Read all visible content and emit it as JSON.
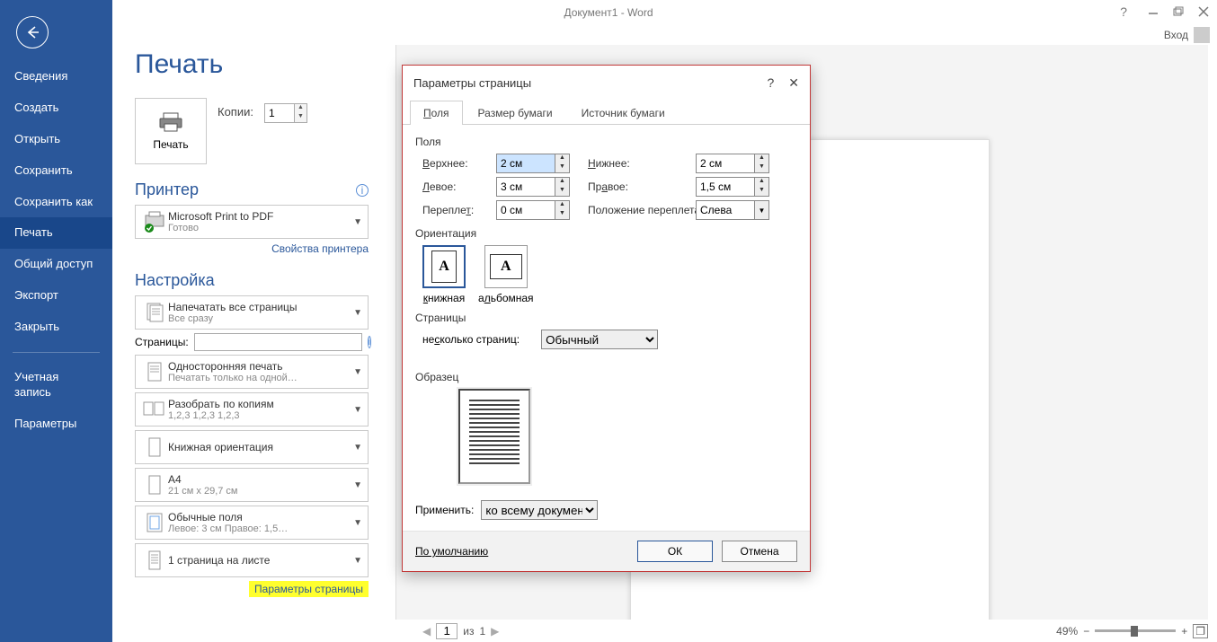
{
  "title": "Документ1 - Word",
  "login": "Вход",
  "sidebar": {
    "items": [
      "Сведения",
      "Создать",
      "Открыть",
      "Сохранить",
      "Сохранить как",
      "Печать",
      "Общий доступ",
      "Экспорт",
      "Закрыть"
    ],
    "items2": [
      "Учетная запись",
      "Параметры"
    ],
    "active": "Печать"
  },
  "print": {
    "heading": "Печать",
    "button": "Печать",
    "copies_label": "Копии:",
    "copies_value": "1",
    "printer_title": "Принтер",
    "printer_name": "Microsoft Print to PDF",
    "printer_status": "Готово",
    "printer_properties": "Свойства принтера",
    "settings_title": "Настройка",
    "setting1": {
      "l1": "Напечатать все страницы",
      "l2": "Все сразу"
    },
    "pages_label": "Страницы:",
    "pages_value": "",
    "setting2": {
      "l1": "Односторонняя печать",
      "l2": "Печатать только на одной…"
    },
    "setting3": {
      "l1": "Разобрать по копиям",
      "l2": "1,2,3   1,2,3   1,2,3"
    },
    "setting4": {
      "l1": "Книжная ориентация"
    },
    "setting5": {
      "l1": "A4",
      "l2": "21 см x 29,7 см"
    },
    "setting6": {
      "l1": "Обычные поля",
      "l2": "Левое:  3 см   Правое:  1,5…"
    },
    "setting7": {
      "l1": "1 страница на листе"
    },
    "page_setup_link": "Параметры страницы"
  },
  "status": {
    "page": "1",
    "of_label": "из",
    "total": "1",
    "zoom": "49%"
  },
  "dialog": {
    "title": "Параметры страницы",
    "tabs": [
      "Поля",
      "Размер бумаги",
      "Источник бумаги"
    ],
    "active_tab": "Поля",
    "fields_label": "Поля",
    "top_label": "Верхнее:",
    "top_value": "2 см",
    "bottom_label": "Нижнее:",
    "bottom_value": "2 см",
    "left_label": "Левое:",
    "left_value": "3 см",
    "right_label": "Правое:",
    "right_value": "1,5 см",
    "gutter_label": "Переплет:",
    "gutter_value": "0 см",
    "gutter_pos_label": "Положение переплета:",
    "gutter_pos_value": "Слева",
    "orientation_label": "Ориентация",
    "orient_portrait": "книжная",
    "orient_landscape": "альбомная",
    "pages_label": "Страницы",
    "multi_label": "несколько страниц:",
    "multi_value": "Обычный",
    "sample_label": "Образец",
    "apply_label": "Применить:",
    "apply_value": "ко всему документу",
    "default_btn": "По умолчанию",
    "ok": "ОК",
    "cancel": "Отмена"
  }
}
